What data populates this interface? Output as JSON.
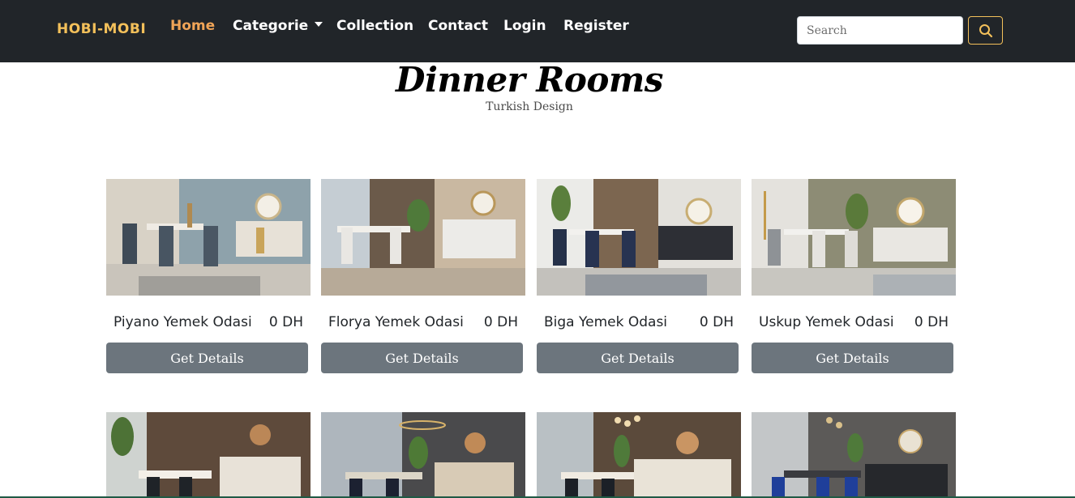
{
  "navbar": {
    "brand": "HOBI-MOBI",
    "links": [
      {
        "label": "Home",
        "active": true
      },
      {
        "label": "Categorie",
        "dropdown": true
      },
      {
        "label": "Collection"
      },
      {
        "label": "Contact"
      },
      {
        "label": "Login"
      },
      {
        "label": "Register"
      }
    ],
    "search_placeholder": "Search",
    "search_icon": "search-icon",
    "accent_color": "#f3c05a",
    "active_color": "#f0a457",
    "background": "#212529"
  },
  "header": {
    "title": "Dinner Rooms",
    "subtitle": "Turkish Design"
  },
  "products": [
    {
      "name": "Piyano Yemek Odasi",
      "price": "0 DH",
      "button": "Get Details"
    },
    {
      "name": "Florya Yemek Odasi",
      "price": "0 DH",
      "button": "Get Details"
    },
    {
      "name": "Biga Yemek Odasi",
      "price": "0 DH",
      "button": "Get Details"
    },
    {
      "name": "Uskup Yemek Odasi",
      "price": "0 DH",
      "button": "Get Details"
    }
  ],
  "button_color": "#6c757d"
}
